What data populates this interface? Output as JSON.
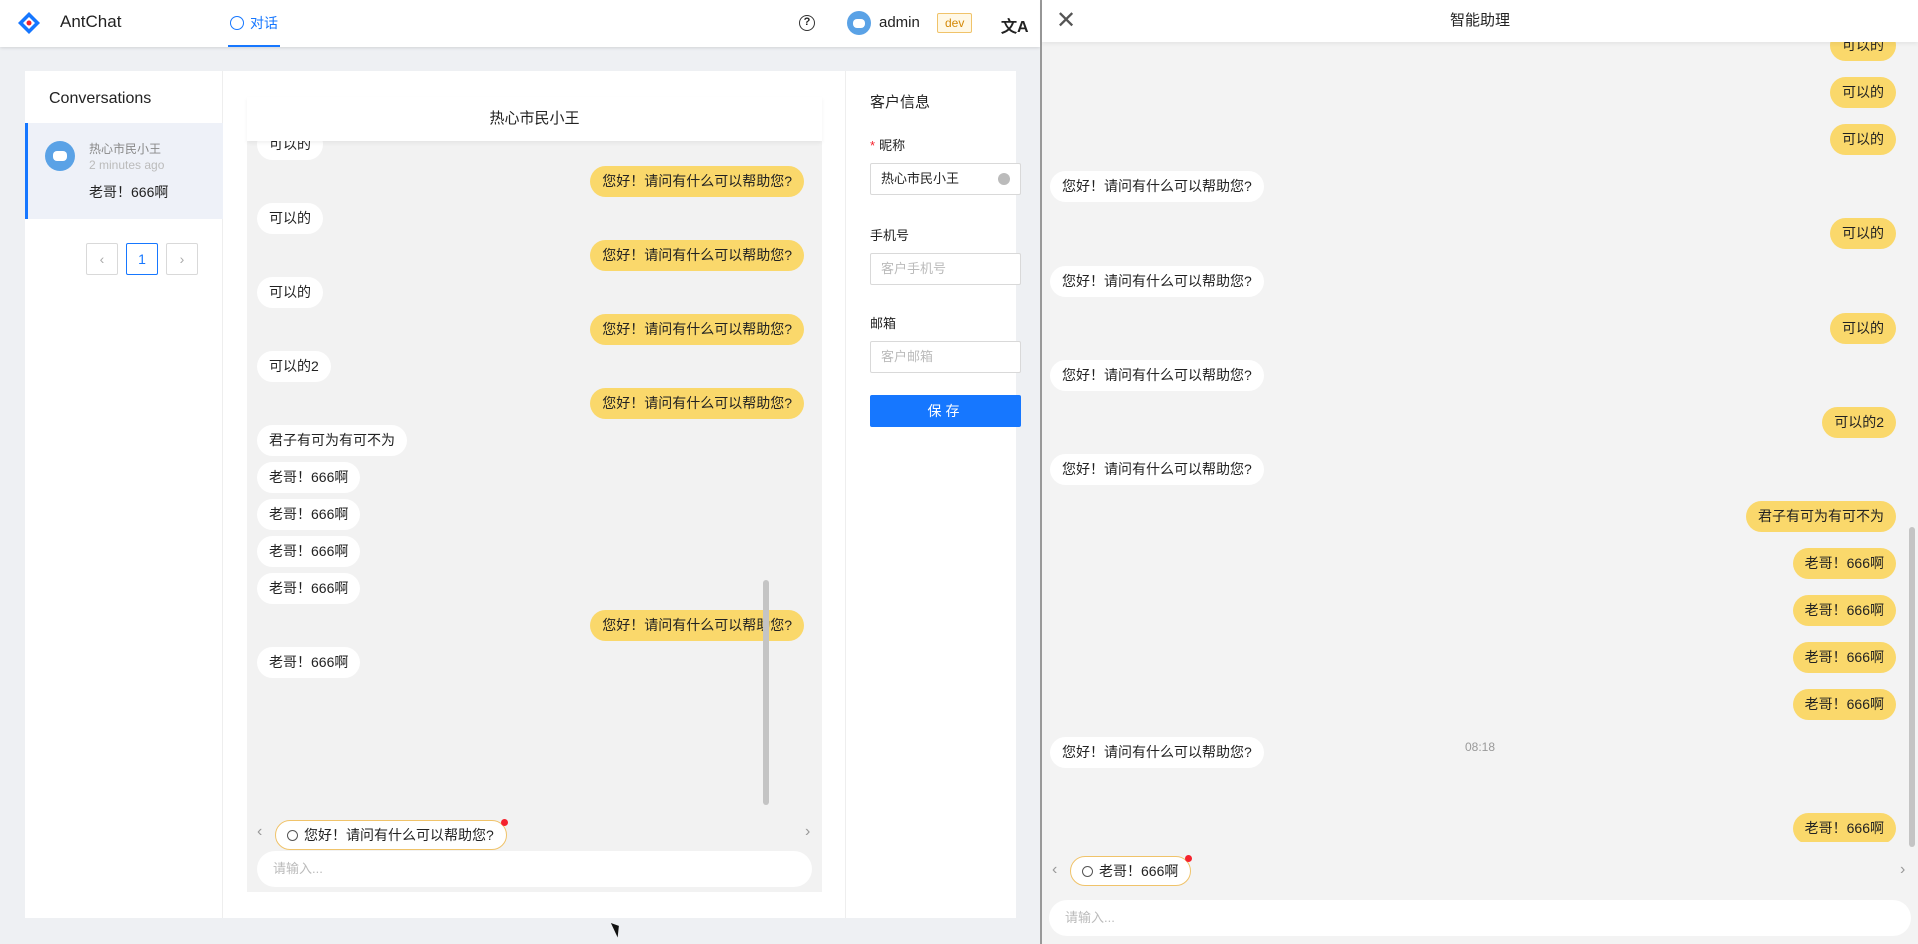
{
  "topbar": {
    "brand": "AntChat",
    "nav_tab": "对话",
    "user": "admin",
    "env": "dev"
  },
  "conversations": {
    "title": "Conversations",
    "items": [
      {
        "name": "热心市民小王",
        "time": "2 minutes ago",
        "last": "老哥！666啊"
      }
    ],
    "pagination": {
      "prev": "‹",
      "current": "1",
      "next": "›"
    }
  },
  "chat": {
    "title": "热心市民小王",
    "messages": [
      {
        "dir": "in",
        "text": "可以的"
      },
      {
        "dir": "out",
        "text": "您好！请问有什么可以帮助您?"
      },
      {
        "dir": "in",
        "text": "可以的"
      },
      {
        "dir": "out",
        "text": "您好！请问有什么可以帮助您?"
      },
      {
        "dir": "in",
        "text": "可以的"
      },
      {
        "dir": "out",
        "text": "您好！请问有什么可以帮助您?"
      },
      {
        "dir": "in",
        "text": "可以的2"
      },
      {
        "dir": "out",
        "text": "您好！请问有什么可以帮助您?"
      },
      {
        "dir": "in",
        "text": "君子有可为有可不为"
      },
      {
        "dir": "in",
        "text": "老哥！666啊"
      },
      {
        "dir": "in",
        "text": "老哥！666啊"
      },
      {
        "dir": "in",
        "text": "老哥！666啊"
      },
      {
        "dir": "in",
        "text": "老哥！666啊"
      },
      {
        "dir": "out",
        "text": "您好！请问有什么可以帮助您?"
      },
      {
        "dir": "in",
        "text": "老哥！666啊"
      }
    ],
    "quick_reply": "您好！请问有什么可以帮助您?",
    "input_placeholder": "请输入..."
  },
  "customer": {
    "title": "客户信息",
    "nickname_label": "昵称",
    "nickname_value": "热心市民小王",
    "phone_label": "手机号",
    "phone_placeholder": "客户手机号",
    "email_label": "邮箱",
    "email_placeholder": "客户邮箱",
    "save": "保存"
  },
  "assistant": {
    "title": "智能助理",
    "messages": [
      {
        "dir": "out",
        "text": "可以的"
      },
      {
        "dir": "out",
        "text": "可以的"
      },
      {
        "dir": "out",
        "text": "可以的"
      },
      {
        "dir": "in",
        "text": "您好！请问有什么可以帮助您?"
      },
      {
        "dir": "out",
        "text": "可以的"
      },
      {
        "dir": "in",
        "text": "您好！请问有什么可以帮助您?"
      },
      {
        "dir": "out",
        "text": "可以的"
      },
      {
        "dir": "in",
        "text": "您好！请问有什么可以帮助您?"
      },
      {
        "dir": "out",
        "text": "可以的2"
      },
      {
        "dir": "in",
        "text": "您好！请问有什么可以帮助您?"
      },
      {
        "dir": "out",
        "text": "君子有可为有可不为"
      },
      {
        "dir": "out",
        "text": "老哥！666啊"
      },
      {
        "dir": "out",
        "text": "老哥！666啊"
      },
      {
        "dir": "out",
        "text": "老哥！666啊"
      },
      {
        "dir": "out",
        "text": "老哥！666啊"
      },
      {
        "dir": "in",
        "text": "您好！请问有什么可以帮助您?"
      },
      {
        "dir": "out",
        "text": "老哥！666啊"
      }
    ],
    "time": "08:18",
    "quick_reply": "老哥！666啊",
    "input_placeholder": "请输入..."
  },
  "colors": {
    "accent": "#1677ff",
    "bubble_out": "#fad86b",
    "bubble_in": "#ffffff"
  }
}
